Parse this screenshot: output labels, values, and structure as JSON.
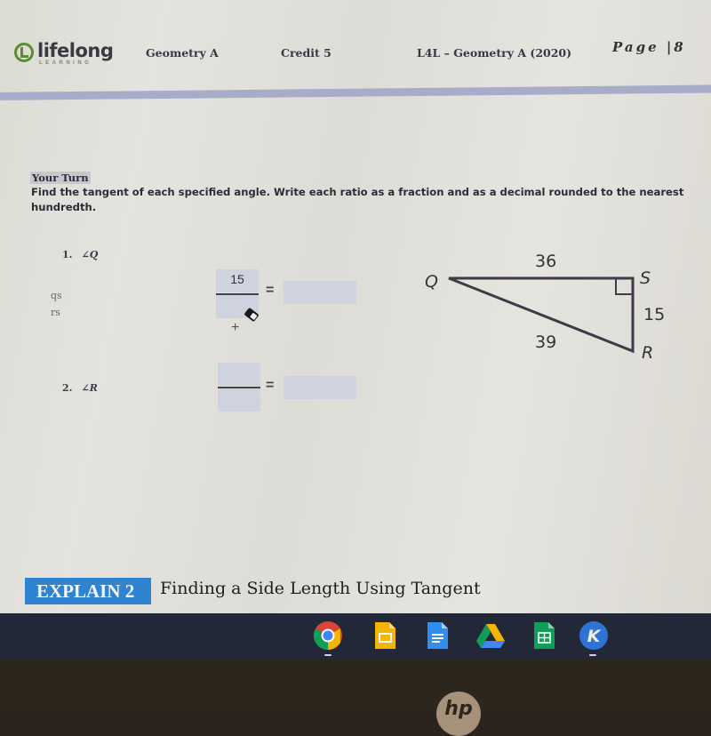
{
  "header": {
    "logo_word": "lifelong",
    "logo_sub": "LEARNING",
    "course": "Geometry A",
    "credit": "Credit 5",
    "course_code": "L4L – Geometry A (2020)",
    "page": "Page |8"
  },
  "section": {
    "your_turn": "Your Turn",
    "instructions": "Find the tangent of each specified angle. Write each ratio as a fraction and as a decimal rounded to the nearest hundredth."
  },
  "questions": [
    {
      "number": "1.",
      "angle": "∠Q",
      "numerator": "15",
      "denominator": "",
      "decimal": "",
      "notes": [
        "qs",
        "rs"
      ]
    },
    {
      "number": "2.",
      "angle": "∠R",
      "numerator": "",
      "denominator": "",
      "decimal": ""
    }
  ],
  "diagram": {
    "vertices": {
      "q": "Q",
      "s": "S",
      "r": "R"
    },
    "sides": {
      "qs": "36",
      "sr": "15",
      "qr": "39"
    },
    "right_angle_at": "S"
  },
  "explain": {
    "badge": "EXPLAIN 2",
    "title": "Finding a Side Length Using Tangent",
    "badge_color": "#2f83d1"
  },
  "shelf": {
    "apps": [
      {
        "name": "Chrome",
        "icon": "chrome-icon",
        "running": true
      },
      {
        "name": "Google Slides",
        "icon": "slides-icon",
        "running": false
      },
      {
        "name": "Google Docs",
        "icon": "docs-icon",
        "running": false
      },
      {
        "name": "Google Drive",
        "icon": "drive-icon",
        "running": false
      },
      {
        "name": "Google Sheets",
        "icon": "sheets-icon",
        "running": false
      },
      {
        "name": "Kahoot",
        "icon": "kahoot-icon",
        "letter": "K",
        "running": true
      }
    ]
  },
  "device": {
    "brand": "hp"
  }
}
